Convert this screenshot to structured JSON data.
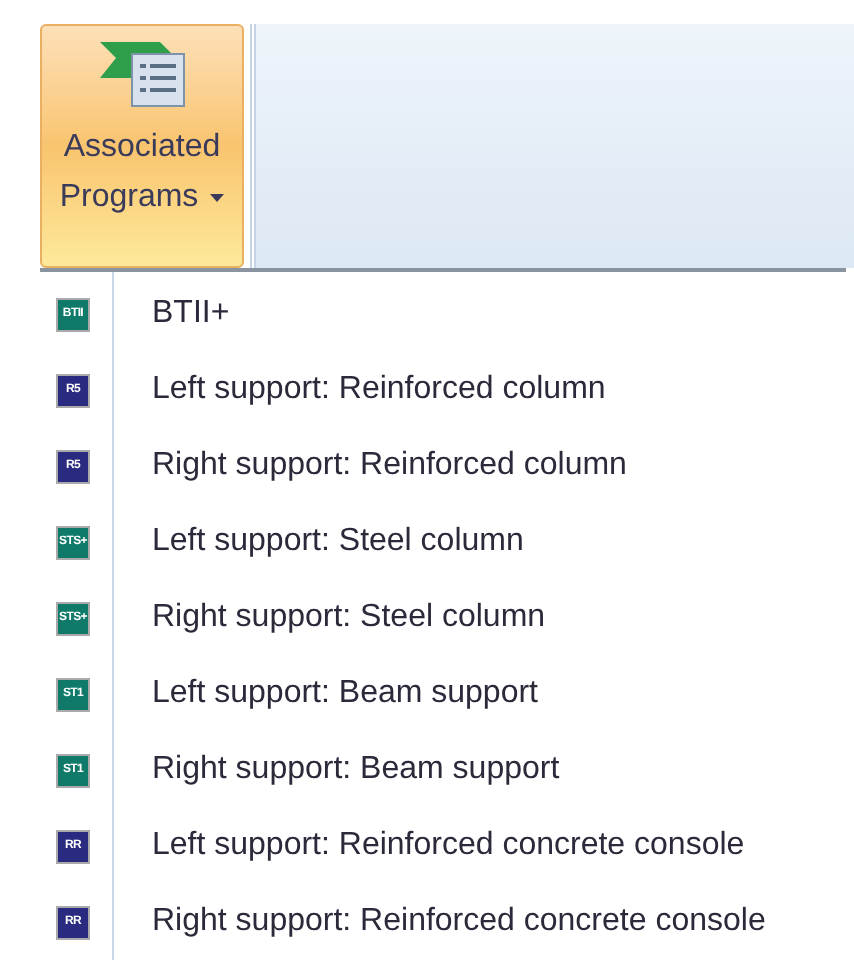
{
  "ribbon_button": {
    "label_line_1": "Associated",
    "label_line_2": "Programs",
    "selected": true
  },
  "menu": {
    "items": [
      {
        "icon_text": "BTII",
        "color": "#0f7a6a",
        "label": "BTII+"
      },
      {
        "icon_text": "R5",
        "color": "#2a2a80",
        "label": "Left support: Reinforced column"
      },
      {
        "icon_text": "R5",
        "color": "#2a2a80",
        "label": "Right support: Reinforced column"
      },
      {
        "icon_text": "STS+",
        "color": "#0f7a6a",
        "label": "Left support: Steel column"
      },
      {
        "icon_text": "STS+",
        "color": "#0f7a6a",
        "label": "Right support: Steel column"
      },
      {
        "icon_text": "ST1",
        "color": "#0f7a6a",
        "label": "Left support: Beam support"
      },
      {
        "icon_text": "ST1",
        "color": "#0f7a6a",
        "label": "Right support: Beam support"
      },
      {
        "icon_text": "RR",
        "color": "#2a2a80",
        "label": "Left support: Reinforced concrete console"
      },
      {
        "icon_text": "RR",
        "color": "#2a2a80",
        "label": "Right support: Reinforced concrete console"
      }
    ]
  }
}
